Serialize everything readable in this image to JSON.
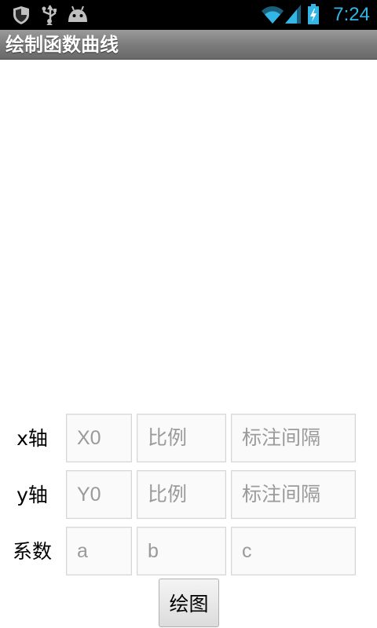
{
  "status_bar": {
    "time": "7:24",
    "icons": [
      "shield-icon",
      "usb-icon",
      "android-icon",
      "wifi-icon",
      "signal-icon",
      "battery-charging-icon"
    ],
    "accent_color": "#33b5e5"
  },
  "title_bar": {
    "title": "绘制函数曲线"
  },
  "form": {
    "x_axis": {
      "label": "x轴",
      "origin_placeholder": "X0",
      "scale_placeholder": "比例",
      "interval_placeholder": "标注间隔"
    },
    "y_axis": {
      "label": "y轴",
      "origin_placeholder": "Y0",
      "scale_placeholder": "比例",
      "interval_placeholder": "标注间隔"
    },
    "coefficients": {
      "label": "系数",
      "a_placeholder": "a",
      "b_placeholder": "b",
      "c_placeholder": "c"
    },
    "draw_button": "绘图"
  }
}
